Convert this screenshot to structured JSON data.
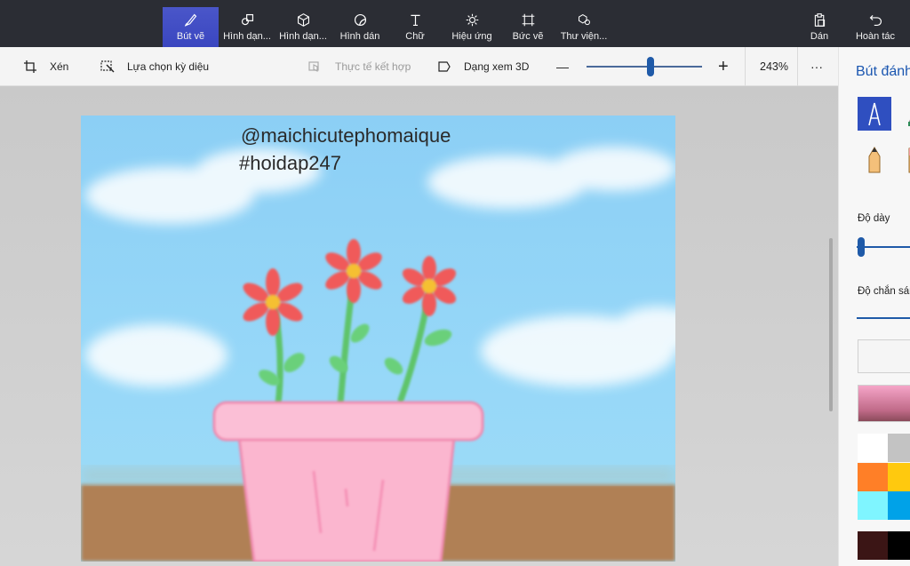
{
  "ribbon": {
    "tools": [
      {
        "label": "Bút vẽ",
        "icon": "brushes-icon",
        "active": true
      },
      {
        "label": "Hình dạn...",
        "icon": "2d-shapes-icon",
        "active": false
      },
      {
        "label": "Hình dạn...",
        "icon": "3d-shapes-icon",
        "active": false
      },
      {
        "label": "Hình dán",
        "icon": "stickers-icon",
        "active": false
      },
      {
        "label": "Chữ",
        "icon": "text-icon",
        "active": false
      },
      {
        "label": "Hiệu ứng",
        "icon": "effects-icon",
        "active": false
      },
      {
        "label": "Bức vẽ",
        "icon": "canvas-icon",
        "active": false
      },
      {
        "label": "Thư viện...",
        "icon": "3d-library-icon",
        "active": false
      }
    ],
    "paste_label": "Dán",
    "undo_label": "Hoàn tác"
  },
  "cmdbar": {
    "crop_label": "Xén",
    "magic_select_label": "Lựa chọn kỳ diệu",
    "mixed_reality_label": "Thực tế kết hợp",
    "view3d_label": "Dạng xem 3D",
    "zoom_minus": "—",
    "zoom_plus": "+",
    "zoom_level": "243%",
    "more": "···",
    "zoom_fraction": 0.55
  },
  "canvas": {
    "line1": "@maichicutephomaique",
    "line2": "#hoidap247"
  },
  "panel": {
    "title": "Bút đánh dấu",
    "thickness_label": "Độ dày",
    "opacity_label": "Độ chắn sáng",
    "swatches": [
      "#ffffff",
      "#c3c3c3",
      "#ff7f27",
      "#ffc90e",
      "#7ff5ff",
      "#00a2e8",
      "#3b1515",
      "#000000"
    ]
  },
  "colors": {
    "accent": "#3f4fc8",
    "ribbon_bg": "#2b2d34",
    "zoom_blue": "#1f5aa8"
  }
}
